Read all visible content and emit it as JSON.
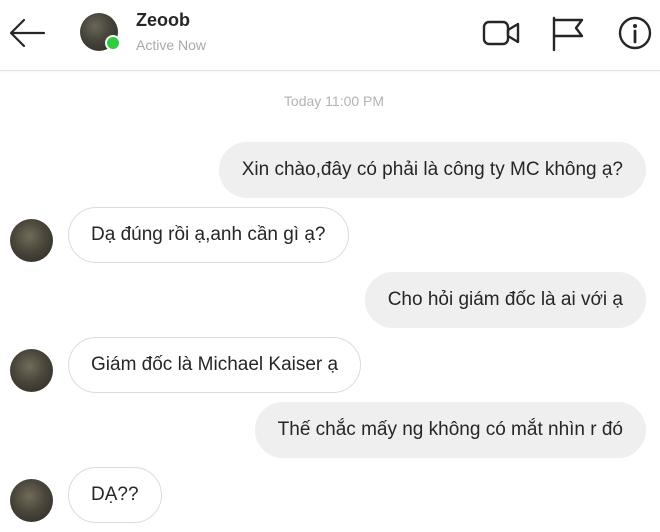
{
  "header": {
    "contact_name": "Zeoob",
    "status": "Active Now",
    "online_color": "#2ecc40",
    "icons": {
      "back": "arrow-left-icon",
      "video": "video-camera-icon",
      "flag": "flag-icon",
      "info": "info-icon"
    }
  },
  "thread": {
    "timestamp": "Today 11:00 PM",
    "messages": [
      {
        "direction": "sent",
        "text": "Xin chào,đây có phải là công ty MC không ạ?"
      },
      {
        "direction": "received",
        "text": "Dạ đúng rồi ạ,anh cần gì ạ?"
      },
      {
        "direction": "sent",
        "text": "Cho hỏi giám đốc là ai với ạ"
      },
      {
        "direction": "received",
        "text": "Giám đốc là Michael Kaiser ạ"
      },
      {
        "direction": "sent",
        "text": "Thế chắc mấy ng không có mắt nhìn r đó"
      },
      {
        "direction": "received",
        "text": "DẠ??"
      }
    ]
  }
}
